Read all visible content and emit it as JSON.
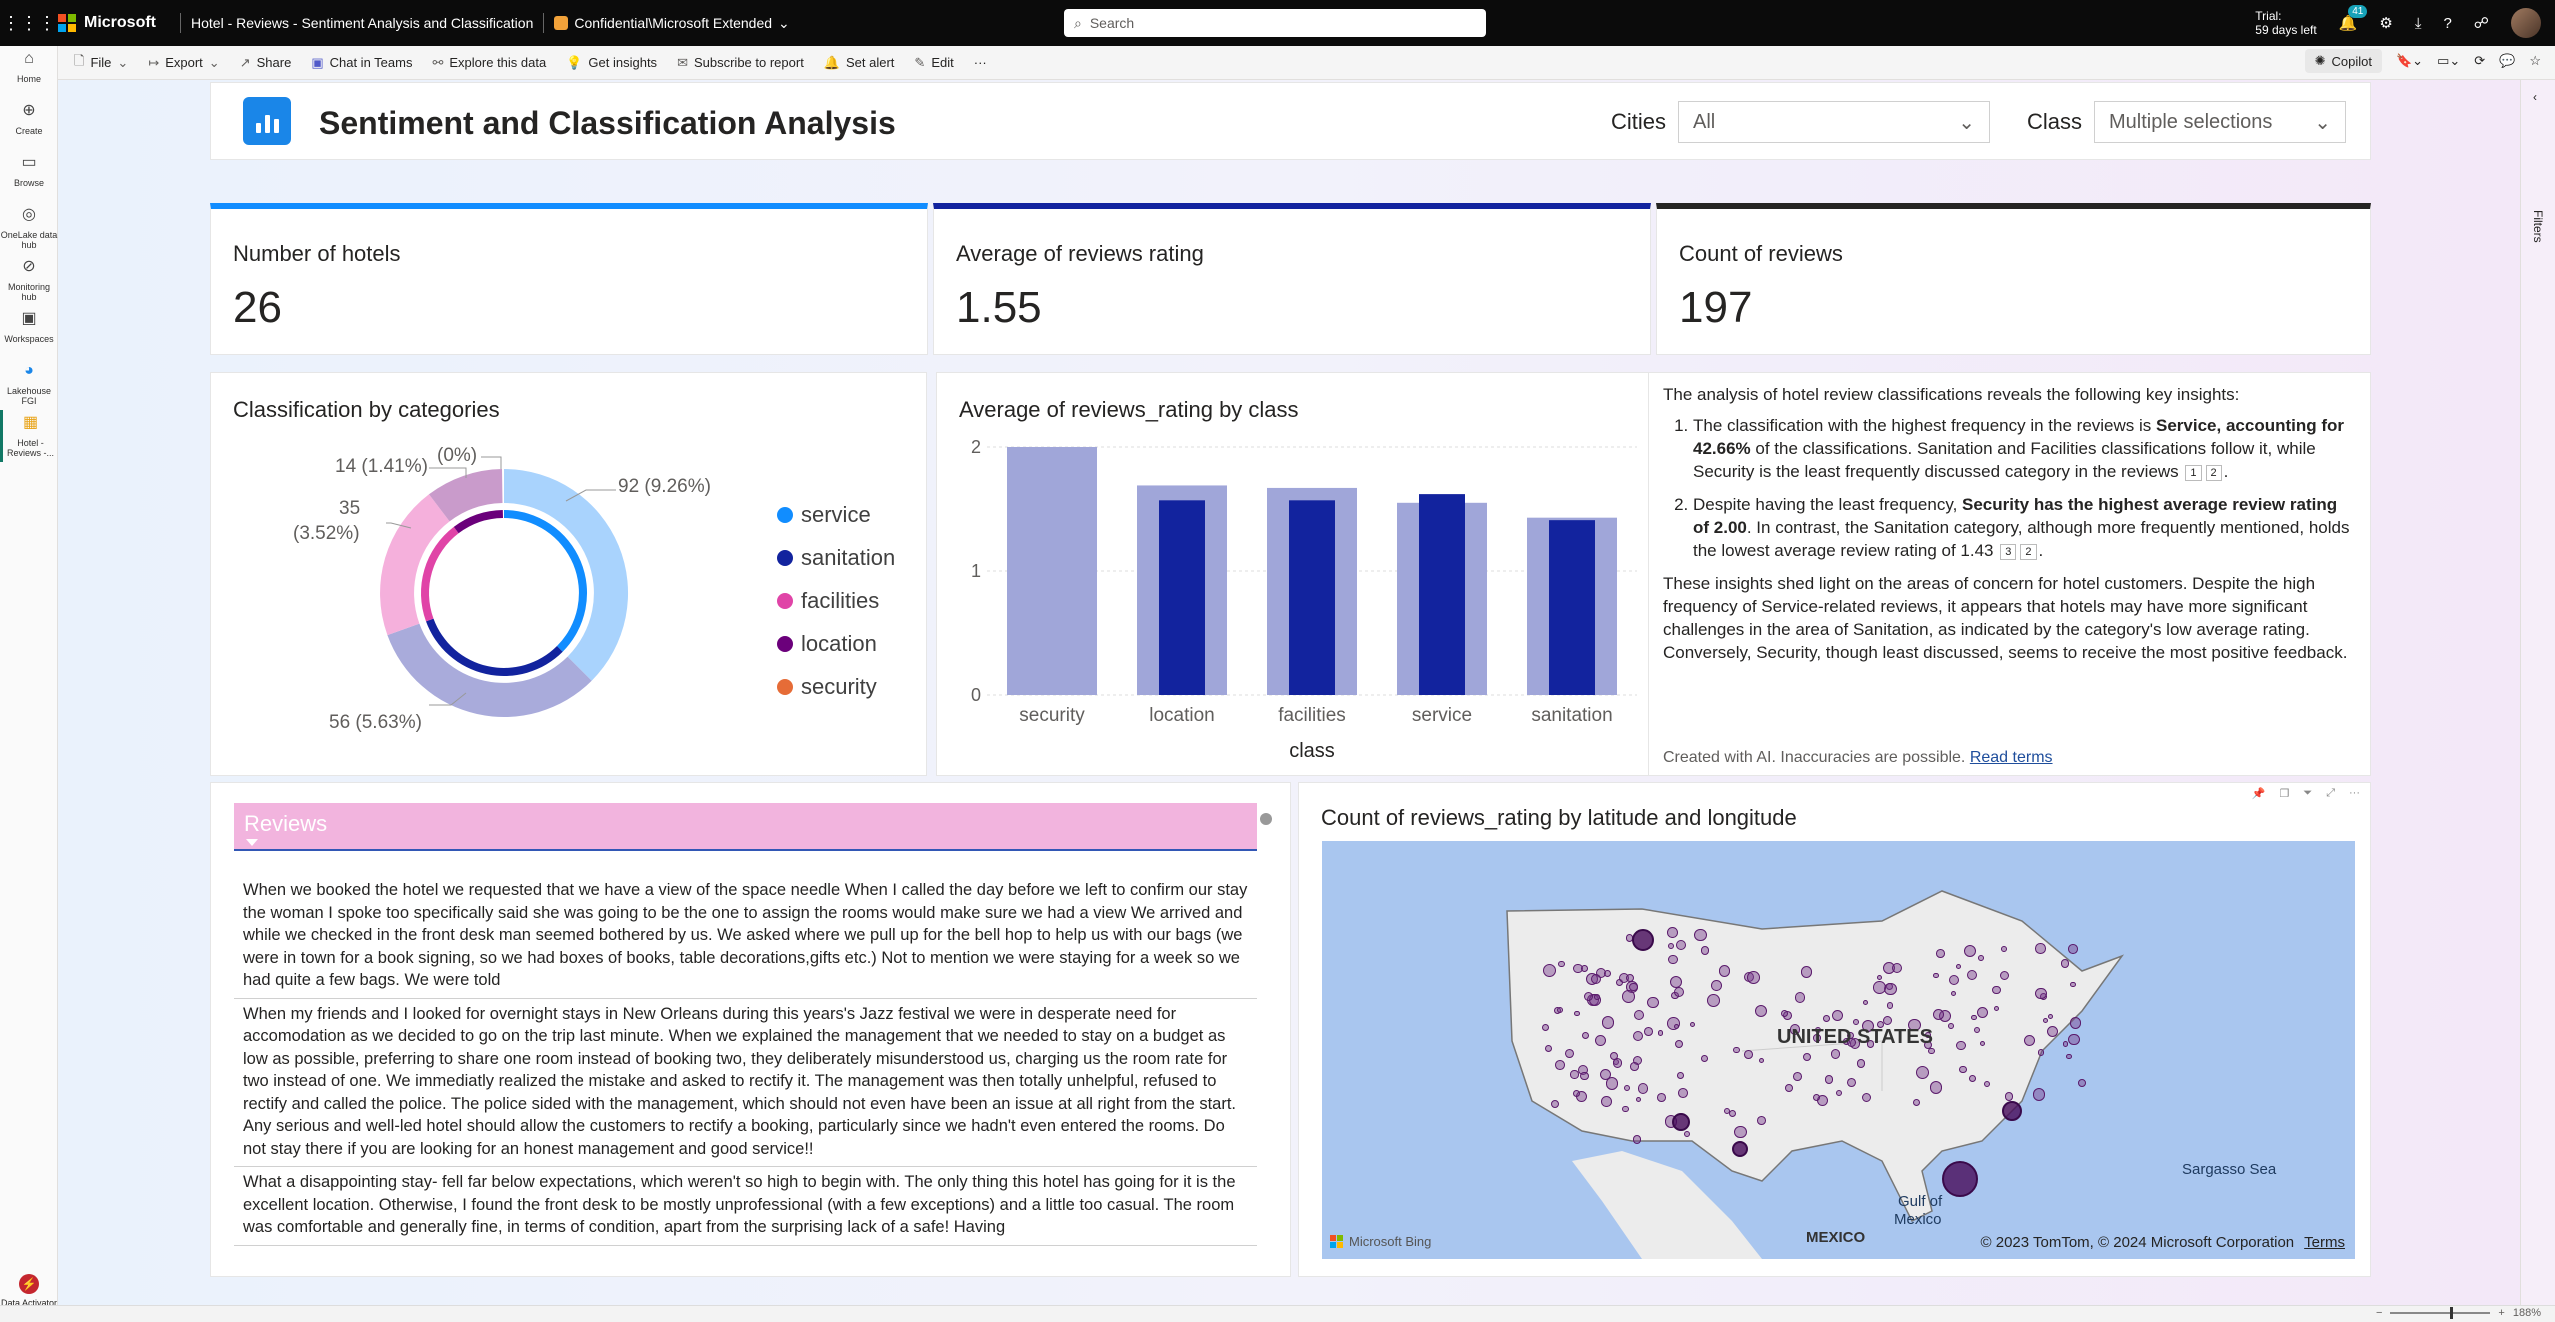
{
  "topbar": {
    "brand": "Microsoft",
    "title": "Hotel - Reviews - Sentiment Analysis and Classification",
    "confidential": "Confidential\\Microsoft Extended",
    "search_placeholder": "Search",
    "trial_line1": "Trial:",
    "trial_line2": "59 days left",
    "notifications": "41"
  },
  "leftnav": {
    "items": [
      {
        "label": "Home"
      },
      {
        "label": "Create"
      },
      {
        "label": "Browse"
      },
      {
        "label": "OneLake data hub"
      },
      {
        "label": "Monitoring hub"
      },
      {
        "label": "Workspaces"
      },
      {
        "label": "Lakehouse FGI"
      },
      {
        "label": "Hotel - Reviews -..."
      }
    ],
    "bottom_label": "Data Activator"
  },
  "toolbar": {
    "file": "File",
    "export": "Export",
    "share": "Share",
    "chat": "Chat in Teams",
    "explore": "Explore this data",
    "insights": "Get insights",
    "subscribe": "Subscribe to report",
    "alert": "Set alert",
    "edit": "Edit",
    "more": "···",
    "copilot": "Copilot"
  },
  "header": {
    "title": "Sentiment and Classification Analysis",
    "cities_label": "Cities",
    "cities_value": "All",
    "class_label": "Class",
    "class_value": "Multiple selections"
  },
  "kpis": [
    {
      "label": "Number of hotels",
      "value": "26",
      "color": "#118dff"
    },
    {
      "label": "Average of reviews rating",
      "value": "1.55",
      "color": "#12239e"
    },
    {
      "label": "Count of reviews",
      "value": "197",
      "color": "#252423"
    }
  ],
  "donut": {
    "title": "Classification by categories",
    "labels": {
      "service": "92 (9.26%)",
      "sanitation": "56 (5.63%)",
      "facilities_a": "35",
      "facilities_b": "(3.52%)",
      "location": "14 (1.41%)",
      "security": "(0%)"
    },
    "legend": [
      {
        "name": "service",
        "color": "#118dff"
      },
      {
        "name": "sanitation",
        "color": "#12239e"
      },
      {
        "name": "facilities",
        "color": "#e044a7"
      },
      {
        "name": "location",
        "color": "#6b007b"
      },
      {
        "name": "security",
        "color": "#e66c37"
      }
    ]
  },
  "insight": {
    "intro": "The analysis of hotel review classifications reveals the following key insights:",
    "p1_a": "The classification with the highest frequency in the reviews is ",
    "p1_b": "Service, accounting for 42.66%",
    "p1_c": " of the classifications. Sanitation and Facilities classifications follow it, while Security is the least frequently discussed category in the reviews",
    "p2_a": "Despite having the least frequency, ",
    "p2_b": "Security has the highest average review rating of 2.00",
    "p2_c": ". In contrast, the Sanitation category, although more frequently mentioned, holds the lowest average review rating of 1.43",
    "summary": "These insights shed light on the areas of concern for hotel customers. Despite the high frequency of Service-related reviews, it appears that hotels may have more significant challenges in the area of Sanitation, as indicated by the category's low average rating. Conversely, Security, though least discussed, seems to receive the most positive feedback.",
    "refs": [
      "1",
      "2",
      "3",
      "2"
    ],
    "footer": "Created with AI. Inaccuracies are possible.",
    "terms": "Read terms"
  },
  "reviews": {
    "title": "Reviews",
    "rows": [
      "When we booked the hotel we requested that we have a view of the space needle When I called the day before we left to confirm our stay the woman I spoke too specifically said she was going to be the one to assign the rooms would make sure we had a view We arrived and while we checked in the front desk man seemed bothered by us. We asked where we pull up for the bell hop to help us with our bags (we were in town for a book signing, so we had boxes of books, table decorations,gifts etc.) Not to mention we were staying for a week so we had quite a few bags. We were told",
      "When my friends and I looked for overnight stays in New Orleans during this years's Jazz festival we were in desperate need for accomodation as we decided to go on the trip last minute. When we explained the management that we needed to stay on a budget as low as possible, preferring to share one room instead of booking two, they deliberately misunderstood us, charging us the room rate for two instead of one. We immediatly realized the mistake and asked to rectify it. The management was then totally unhelpful, refused to rectify and called the police. The police sided with the management, which should not even have been an issue at all right from the start. Any serious and well-led hotel should allow the customers to rectify a booking, particularly since we hadn't even entered the rooms. Do not stay there if you are looking for an honest management and good service!!",
      "What a disappointing stay- fell far below expectations, which weren't so high to begin with. The only thing this hotel has going for it is the excellent location. Otherwise, I found the front desk to be mostly unprofessional (with a few exceptions) and a little too casual. The room was comfortable and generally fine, in terms of condition, apart from the surprising lack of a safe! Having"
    ]
  },
  "map": {
    "title": "Count of reviews_rating by latitude and longitude",
    "country": "UNITED STATES",
    "sea": "Sargasso Sea",
    "gulf_a": "Gulf of",
    "gulf_b": "Mexico",
    "mexico": "MEXICO",
    "bing": "Microsoft Bing",
    "copyright": "© 2023 TomTom, © 2024 Microsoft Corporation",
    "terms": "Terms"
  },
  "status": {
    "zoom": "188%"
  },
  "chart_data": {
    "type": "bar",
    "title": "Average of reviews_rating by class",
    "xlabel": "class",
    "ylabel": "",
    "categories": [
      "security",
      "location",
      "facilities",
      "service",
      "sanitation"
    ],
    "series": [
      {
        "values": [
          2.0,
          1.69,
          1.67,
          1.55,
          1.43
        ],
        "color": "#a0a6d9"
      },
      {
        "values": [
          0,
          1.57,
          1.57,
          1.62,
          1.41
        ],
        "color": "#12239e"
      }
    ],
    "ylim": [
      0,
      2
    ],
    "yticks": [
      "0",
      "1",
      "2"
    ],
    "grid": true
  }
}
